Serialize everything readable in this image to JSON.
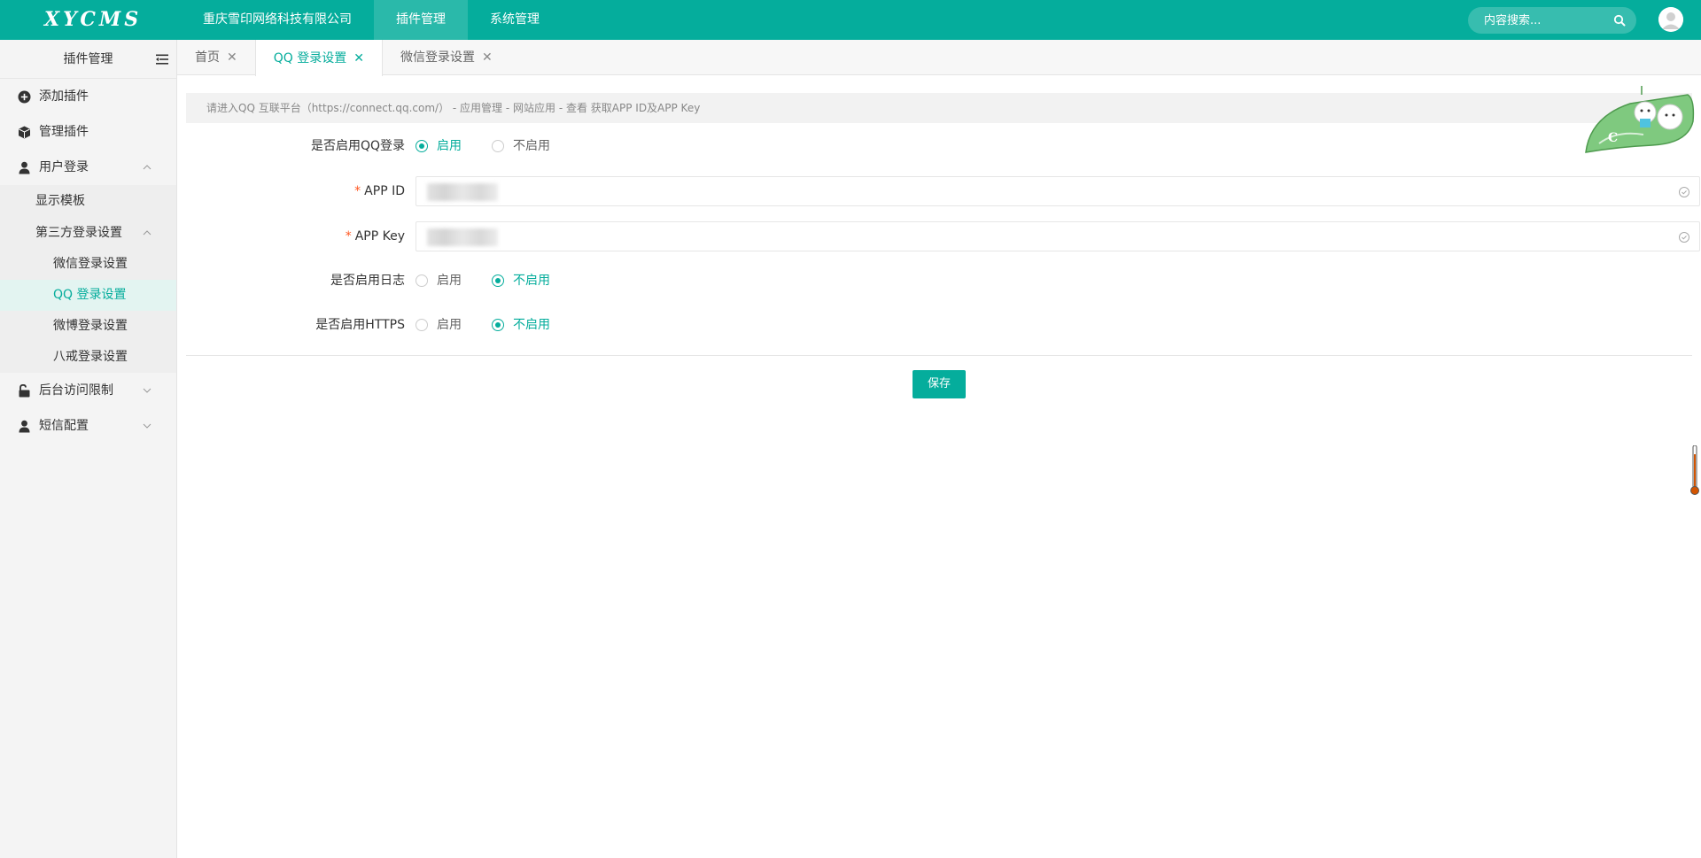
{
  "app": {
    "logo": "XYCMS"
  },
  "topnav": [
    "重庆雪印网络科技有限公司",
    "插件管理",
    "系统管理"
  ],
  "search": {
    "placeholder": "内容搜索..."
  },
  "sidebar": {
    "title": "插件管理",
    "items": [
      {
        "label": "添加插件",
        "icon": "plus-circle-icon"
      },
      {
        "label": "管理插件",
        "icon": "cube-icon"
      },
      {
        "label": "用户登录",
        "icon": "user-icon"
      },
      {
        "label": "显示模板"
      },
      {
        "label": "第三方登录设置"
      },
      {
        "label": "微信登录设置"
      },
      {
        "label": "QQ 登录设置"
      },
      {
        "label": "微博登录设置"
      },
      {
        "label": "八戒登录设置"
      },
      {
        "label": "后台访问限制",
        "icon": "unlock-icon"
      },
      {
        "label": "短信配置",
        "icon": "user-icon"
      }
    ]
  },
  "tabs": [
    {
      "label": "首页"
    },
    {
      "label": "QQ 登录设置"
    },
    {
      "label": "微信登录设置"
    }
  ],
  "tip": "请进入QQ 互联平台（https://connect.qq.com/） - 应用管理 - 网站应用 - 查看 获取APP ID及APP Key",
  "form": {
    "enable_qq": {
      "label": "是否启用QQ登录",
      "on": "启用",
      "off": "不启用"
    },
    "app_id": {
      "label": "APP ID"
    },
    "app_key": {
      "label": "APP Key"
    },
    "enable_log": {
      "label": "是否启用日志",
      "on": "启用",
      "off": "不启用"
    },
    "enable_https": {
      "label": "是否启用HTTPS",
      "on": "启用",
      "off": "不启用"
    },
    "save": "保存"
  },
  "colors": {
    "primary": "#05ad9c",
    "required": "#ff5722"
  }
}
